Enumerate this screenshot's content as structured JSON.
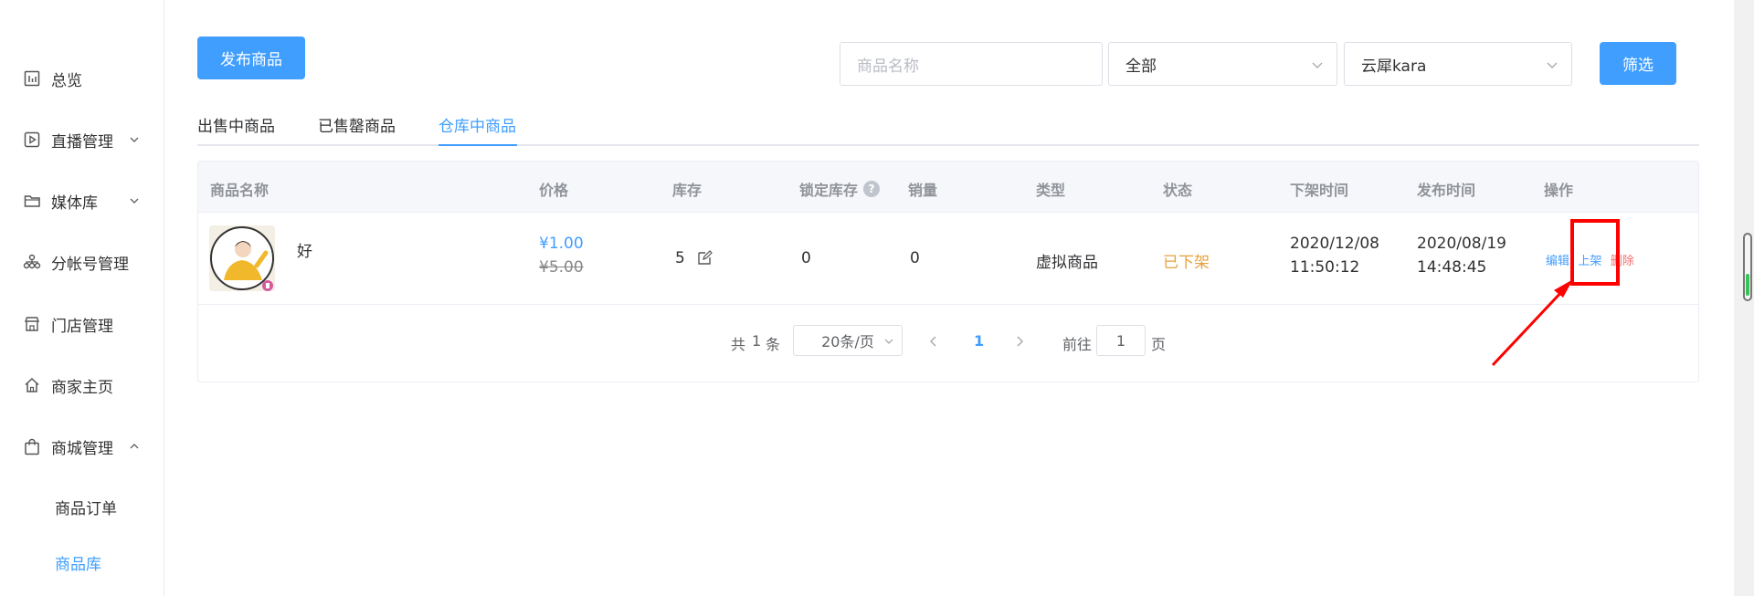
{
  "sidebar": {
    "items": [
      {
        "label": "总览",
        "icon": "chart-icon"
      },
      {
        "label": "直播管理",
        "icon": "play-icon",
        "chevron": "down"
      },
      {
        "label": "媒体库",
        "icon": "folder-icon",
        "chevron": "down"
      },
      {
        "label": "分帐号管理",
        "icon": "org-icon"
      },
      {
        "label": "门店管理",
        "icon": "store-icon"
      },
      {
        "label": "商家主页",
        "icon": "home-icon"
      },
      {
        "label": "商城管理",
        "icon": "bag-icon",
        "chevron": "up"
      }
    ],
    "subitems": [
      {
        "label": "商品订单"
      },
      {
        "label": "商品库",
        "active": true
      }
    ]
  },
  "toolbar": {
    "publish_label": "发布商品",
    "search_placeholder": "商品名称",
    "type_select": "全部",
    "shop_select": "云犀kara",
    "filter_label": "筛选"
  },
  "tabs": [
    "出售中商品",
    "已售罄商品",
    "仓库中商品"
  ],
  "active_tab": 2,
  "table": {
    "headers": [
      "商品名称",
      "价格",
      "库存",
      "锁定库存",
      "销量",
      "类型",
      "状态",
      "下架时间",
      "发布时间",
      "操作"
    ],
    "rows": [
      {
        "name": "好",
        "price": "¥1.00",
        "original_price": "¥5.00",
        "stock": "5",
        "locked_stock": "0",
        "sales": "0",
        "type": "虚拟商品",
        "status": "已下架",
        "off_date": "2020/12/08",
        "off_time": "11:50:12",
        "pub_date": "2020/08/19",
        "pub_time": "14:48:45",
        "actions": [
          "编辑",
          "上架",
          "删除"
        ]
      }
    ]
  },
  "pagination": {
    "total_prefix": "共",
    "total": "1",
    "total_suffix": "条",
    "page_size": "20条/页",
    "current_page": "1",
    "goto_label": "前往",
    "goto_value": "1",
    "goto_suffix": "页"
  },
  "colors": {
    "primary": "#409eff",
    "warning": "#e6a23c",
    "danger": "#f56c6c",
    "annotation": "#ff0000"
  }
}
